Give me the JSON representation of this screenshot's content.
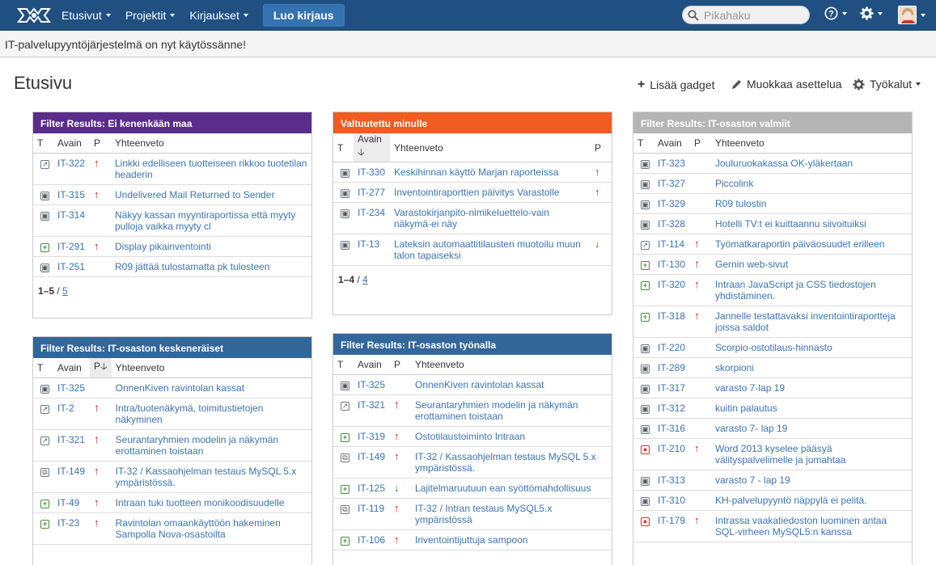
{
  "nav": {
    "menus": [
      "Etusivut",
      "Projektit",
      "Kirjaukset"
    ],
    "create_label": "Luo kirjaus",
    "search_placeholder": "Pikahaku",
    "help_icon": "help-icon",
    "settings_icon": "gear-icon"
  },
  "announcement": "IT-palvelupyyntöjärjestelmä on nyt käytössänne!",
  "page": {
    "title": "Etusivu",
    "add_gadget": "Lisää gadget",
    "edit_layout": "Muokkaa asettelua",
    "tools": "Työkalut"
  },
  "gadgets": [
    {
      "title": "Filter Results: Ei kenenkään maa",
      "headers": [
        "T",
        "Avain",
        "P",
        "Yhteenveto"
      ],
      "rows": [
        {
          "type": "improve",
          "key": "IT-322",
          "pri": "up",
          "summary": "Linkki edelliseen tuotteiseen rikkoo tuotetilan headerin"
        },
        {
          "type": "task",
          "key": "IT-315",
          "pri": "up",
          "summary": "Undelivered Mail Returned to Sender"
        },
        {
          "type": "task",
          "key": "IT-314",
          "pri": "",
          "summary": "Näkyy kassan myyntiraportissa että myyty pulloja vaikka myyty cl"
        },
        {
          "type": "new",
          "key": "IT-291",
          "pri": "up",
          "summary": "Display pikainventointi"
        },
        {
          "type": "task",
          "key": "IT-251",
          "pri": "",
          "summary": "R09 jättää tulostamatta pk tulosteen"
        }
      ],
      "pager": {
        "range": "1–5",
        "sep": " / ",
        "total": "5"
      }
    },
    {
      "title": "Valtuutettu minulle",
      "headers": [
        "T",
        "Avain",
        "Yhteenveto",
        "P"
      ],
      "rows": [
        {
          "type": "task",
          "key": "IT-330",
          "pri": "up",
          "summary": "Keskihinnan käyttö Marjan raporteissa"
        },
        {
          "type": "task",
          "key": "IT-277",
          "pri": "up",
          "summary": "Inventointiraporttien päivitys Varastolle"
        },
        {
          "type": "task",
          "key": "IT-234",
          "pri": "",
          "summary": "Varastokirjanpito-nimikeluettelo-vain näkymä-ei näy"
        },
        {
          "type": "task",
          "key": "IT-13",
          "pri": "down",
          "summary": "Lateksin automaattitilausten muotoilu muun talon tapaiseksi"
        }
      ],
      "pager": {
        "range": "1–4",
        "sep": " / ",
        "total": "4"
      }
    },
    {
      "title": "Filter Results: IT-osaston valmiit",
      "headers": [
        "T",
        "Avain",
        "P",
        "Yhteenveto"
      ],
      "rows": [
        {
          "type": "task",
          "key": "IT-323",
          "pri": "",
          "summary": "Jouluruokakassa OK-yläkertaan"
        },
        {
          "type": "task",
          "key": "IT-327",
          "pri": "",
          "summary": "Piccolink"
        },
        {
          "type": "task",
          "key": "IT-329",
          "pri": "",
          "summary": "R09 tulostin"
        },
        {
          "type": "task",
          "key": "IT-328",
          "pri": "",
          "summary": "Hotelli TV:t ei kuittaannu siivoituiksi"
        },
        {
          "type": "improve",
          "key": "IT-114",
          "pri": "up",
          "summary": "Työmatkaraportin päiväosuudet erilleen"
        },
        {
          "type": "new",
          "key": "IT-130",
          "pri": "crit",
          "summary": "Gernin web-sivut"
        },
        {
          "type": "new",
          "key": "IT-320",
          "pri": "up",
          "summary": "Intraan JavaScript ja CSS tiedostojen yhdistäminen."
        },
        {
          "type": "new",
          "key": "IT-318",
          "pri": "up",
          "summary": "Jannelle testattavaksi inventointiraportteja joissa saldot"
        },
        {
          "type": "task",
          "key": "IT-220",
          "pri": "",
          "summary": "Scorpio-ostotilaus-hinnasto"
        },
        {
          "type": "task",
          "key": "IT-289",
          "pri": "",
          "summary": "skorpioni"
        },
        {
          "type": "task",
          "key": "IT-317",
          "pri": "",
          "summary": "varasto 7-lap 19"
        },
        {
          "type": "task",
          "key": "IT-312",
          "pri": "",
          "summary": "kuitin palautus"
        },
        {
          "type": "task",
          "key": "IT-316",
          "pri": "",
          "summary": "varasto 7- lap 19"
        },
        {
          "type": "bug",
          "key": "IT-210",
          "pri": "up",
          "summary": "Word 2013 kyselee pääsyä välityspalvelimelle ja jumahtaa"
        },
        {
          "type": "task",
          "key": "IT-313",
          "pri": "",
          "summary": "varasto 7 - lap 19"
        },
        {
          "type": "task",
          "key": "IT-310",
          "pri": "",
          "summary": "KH-palvelupyyntö näppylä ei pelitä."
        },
        {
          "type": "bug",
          "key": "IT-179",
          "pri": "up",
          "summary": "Intrassa vaakatiedoston luominen antaa SQL-virheen MySQL5:n kanssa"
        }
      ]
    },
    {
      "title": "Filter Results: IT-osaston keskeneräiset",
      "headers": [
        "T",
        "Avain",
        "P",
        "Yhteenveto"
      ],
      "rows": [
        {
          "type": "task",
          "key": "IT-325",
          "pri": "",
          "summary": "OnnenKiven ravintolan kassat"
        },
        {
          "type": "improve",
          "key": "IT-2",
          "pri": "crit",
          "summary": "Intra/tuotenäkymä, toimitustietojen näkyminen"
        },
        {
          "type": "improve",
          "key": "IT-321",
          "pri": "crit",
          "summary": "Seurantaryhmien modelin ja näkymän erottaminen toistaan"
        },
        {
          "type": "sub",
          "key": "IT-149",
          "pri": "up",
          "summary": "IT-32 / Kassaohjelman testaus MySQL 5.x ympäristössä."
        },
        {
          "type": "new",
          "key": "IT-49",
          "pri": "up",
          "summary": "Intraan tuki tuotteen monikoodisuudelle"
        },
        {
          "type": "new",
          "key": "IT-23",
          "pri": "up",
          "summary": "Ravintolan omaankäyttöön hakeminen Sampolla Nova-osastoilta"
        }
      ]
    },
    {
      "title": "Filter Results: IT-osaston työnalla",
      "headers": [
        "T",
        "Avain",
        "P",
        "Yhteenveto"
      ],
      "rows": [
        {
          "type": "task",
          "key": "IT-325",
          "pri": "",
          "summary": "OnnenKiven ravintolan kassat"
        },
        {
          "type": "improve",
          "key": "IT-321",
          "pri": "crit",
          "summary": "Seurantaryhmien modelin ja näkymän erottaminen toistaan"
        },
        {
          "type": "new",
          "key": "IT-319",
          "pri": "up",
          "summary": "Ostotilaustoiminto Intraan"
        },
        {
          "type": "sub",
          "key": "IT-149",
          "pri": "up",
          "summary": "IT-32 / Kassaohjelman testaus MySQL 5.x ympäristössä."
        },
        {
          "type": "new",
          "key": "IT-125",
          "pri": "down",
          "summary": "Lajitelmaruutuun ean syöttömahdollisuus"
        },
        {
          "type": "sub",
          "key": "IT-119",
          "pri": "up",
          "summary": "IT-32 / Intran testaus MySQL5.x ympäristössä"
        },
        {
          "type": "new",
          "key": "IT-106",
          "pri": "up",
          "summary": "Inventointijuttuja sampoon"
        }
      ]
    }
  ]
}
